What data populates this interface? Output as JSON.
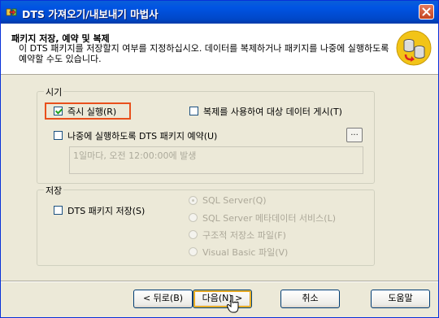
{
  "window": {
    "title": "DTS 가져오기/내보내기 마법사"
  },
  "header": {
    "title": "패키지 저장, 예약 및 복제",
    "description": "이 DTS 패키지를 저장할지 여부를 지정하십시오. 데이터를 복제하거나 패키지를 나중에 실행하도록 예약할 수도 있습니다."
  },
  "when_group": {
    "title": "시기",
    "run_now": {
      "label": "즉시 실행(R)",
      "checked": true
    },
    "replicate": {
      "label": "복제를 사용하여 대상 데이터 게시(T)",
      "checked": false
    },
    "schedule": {
      "label": "나중에 실행하도록 DTS 패키지 예약(U)",
      "checked": false
    },
    "browse_label": "...",
    "schedule_text": "1일마다, 오전 12:00:00에 발생"
  },
  "save_group": {
    "title": "저장",
    "save_package": {
      "label": "DTS 패키지 저장(S)",
      "checked": false
    },
    "options": [
      {
        "label": "SQL Server(Q)",
        "selected": true
      },
      {
        "label": "SQL Server 메타데이터 서비스(L)",
        "selected": false
      },
      {
        "label": "구조적 저장소 파일(F)",
        "selected": false
      },
      {
        "label": "Visual Basic 파일(V)",
        "selected": false
      }
    ]
  },
  "buttons": {
    "back": "< 뒤로(B)",
    "next": "다음(N) >",
    "cancel": "취소",
    "help": "도움말"
  },
  "colors": {
    "titlebar": "#0054e3",
    "dialog": "#ece9d8",
    "focus": "#e8501c"
  }
}
